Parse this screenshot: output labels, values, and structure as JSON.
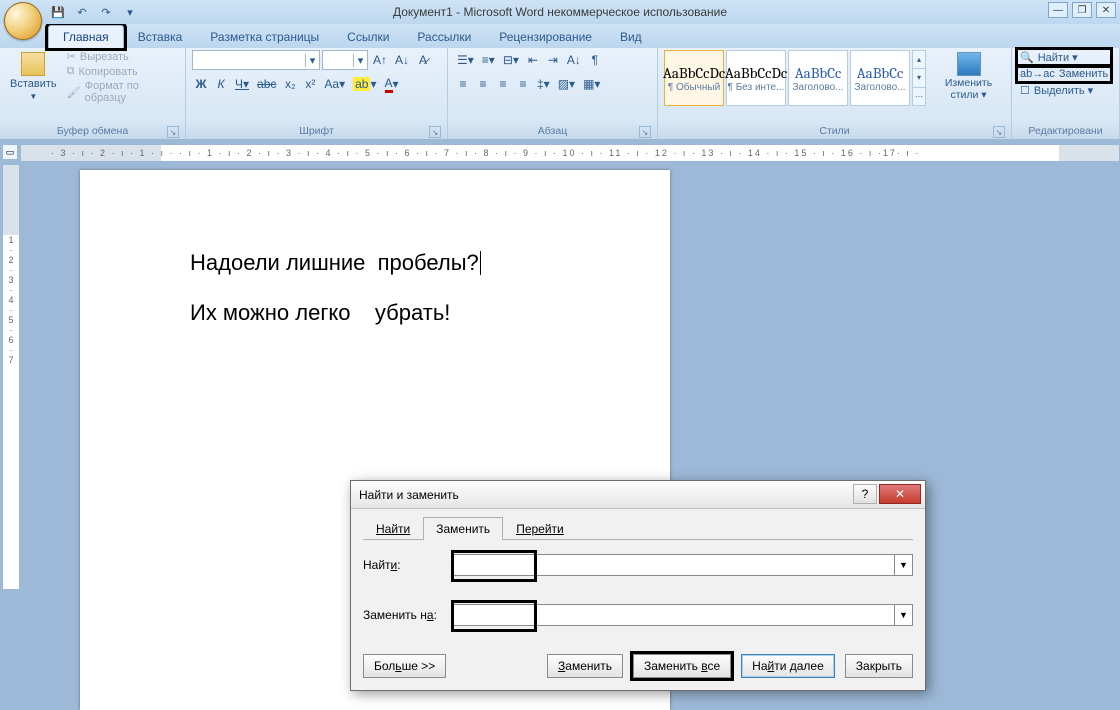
{
  "window": {
    "title": "Документ1 - Microsoft Word некоммерческое использование"
  },
  "qat": {
    "save_icon": "save-icon",
    "undo_icon": "undo-icon",
    "redo_icon": "redo-icon"
  },
  "ribbon_tabs": {
    "home": "Главная",
    "insert": "Вставка",
    "layout": "Разметка страницы",
    "references": "Ссылки",
    "mailings": "Рассылки",
    "review": "Рецензирование",
    "view": "Вид"
  },
  "clipboard": {
    "paste": "Вставить",
    "cut": "Вырезать",
    "copy": "Копировать",
    "format_painter": "Формат по образцу",
    "group_label": "Буфер обмена"
  },
  "font": {
    "family": "",
    "size": "",
    "group_label": "Шрифт",
    "bold": "Ж",
    "italic": "К",
    "underline": "Ч",
    "strike": "abc",
    "sub": "x₂",
    "sup": "x²",
    "case": "Aa",
    "clear": "A"
  },
  "paragraph": {
    "group_label": "Абзац"
  },
  "styles": {
    "group_label": "Стили",
    "items": [
      {
        "preview": "AaBbCcDc",
        "name": "¶ Обычный"
      },
      {
        "preview": "AaBbCcDc",
        "name": "¶ Без инте..."
      },
      {
        "preview": "AaBbCc",
        "name": "Заголово..."
      },
      {
        "preview": "AaBbCc",
        "name": "Заголово..."
      }
    ],
    "change": "Изменить стили ▾"
  },
  "editing": {
    "group_label": "Редактировани",
    "find": "Найти ▾",
    "replace": "Заменить",
    "select": "Выделить ▾"
  },
  "ruler_numbers": "· 3 · ı · 2 · ı · 1 · ı ·   · ı · 1 · ı · 2 · ı · 3 · ı · 4 · ı · 5 · ı · 6 · ı · 7 · ı · 8 · ı · 9 · ı · 10 · ı · 11 · ı · 12 · ı · 13 · ı · 14 · ı · 15 · ı · 16 · ı  ·17· ı ·",
  "document": {
    "line1": "Надоели лишние  пробелы?",
    "line2": "Их можно легко    убрать!"
  },
  "dialog": {
    "title": "Найти и заменить",
    "tabs": {
      "find": "Найти",
      "replace": "Заменить",
      "goto": "Перейти"
    },
    "find_label": "Найти:",
    "replace_label": "Заменить на:",
    "find_value": "",
    "replace_value": "",
    "more": "Больше >>",
    "btn_replace": "Заменить",
    "btn_replace_all": "Заменить все",
    "btn_find_next": "Найти далее",
    "btn_close": "Закрыть",
    "help": "?",
    "close_x": "✕"
  }
}
